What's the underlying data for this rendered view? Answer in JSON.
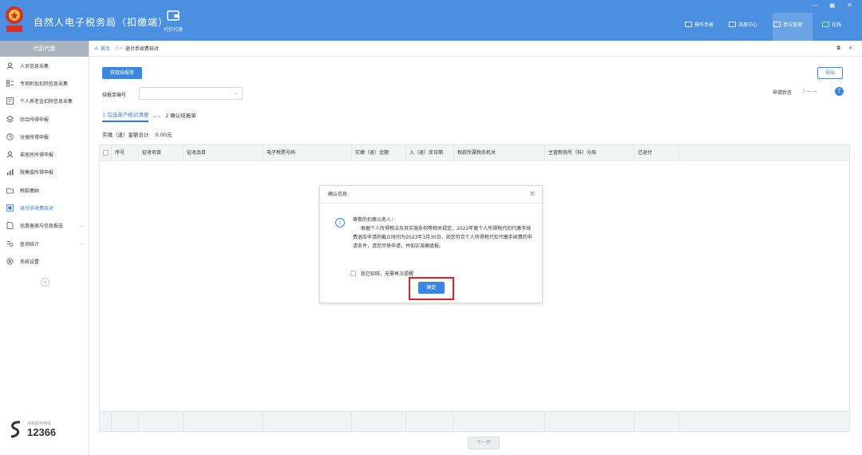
{
  "app": {
    "title": "自然人电子税务局（扣缴端）",
    "logo_text": "中国税务",
    "module_label": "代扣代缴",
    "window_controls": "— ▣ ✕"
  },
  "header": {
    "links": [
      "操作手册",
      "消息中心",
      "单位管理",
      "在线"
    ]
  },
  "sidebar": {
    "title": "代扣代缴",
    "items": [
      {
        "label": "人员信息采集",
        "icon": "person-icon"
      },
      {
        "label": "专项附加扣除信息采集",
        "icon": "list-icon"
      },
      {
        "label": "个人养老金扣除信息采集",
        "icon": "pension-icon"
      },
      {
        "label": "综合所得申报",
        "icon": "layers-icon"
      },
      {
        "label": "分类所得申报",
        "icon": "clock-icon"
      },
      {
        "label": "非居民所得申报",
        "icon": "person-icon"
      },
      {
        "label": "限售股所得申报",
        "icon": "bar-chart-icon"
      },
      {
        "label": "税款缴纳",
        "icon": "folder-icon"
      },
      {
        "label": "退付手续费核对",
        "icon": "document-icon"
      },
      {
        "label": "优惠备案与信息报送",
        "icon": "file-icon"
      },
      {
        "label": "查询统计",
        "icon": "search-list-icon"
      },
      {
        "label": "系统设置",
        "icon": "gear-icon"
      }
    ],
    "active_index": 8,
    "collapse_glyph": "«",
    "hotline_label": "纳税服务热线",
    "hotline_number": "12366"
  },
  "breadcrumb": {
    "home": "首页",
    "separator": ">>",
    "current": "退付手续费核对",
    "tab_controls": "◘ ✕"
  },
  "toolbar": {
    "fetch_label": "获取结报单",
    "export_label": "导出",
    "form_label": "结报单编号",
    "status_label": "申请状态",
    "status_value": "| — —",
    "help_glyph": "?"
  },
  "steps": {
    "step1": "1 勾选单户核对清册",
    "arrow": ">>",
    "step2": "2 确认结报单"
  },
  "total": {
    "label": "实缴（退）金额合计",
    "value": "0.00元"
  },
  "table": {
    "columns": [
      "序号",
      "征收项目",
      "征收品目",
      "电子税票号码",
      "实缴（退）金额",
      "入（退）库日期",
      "税款所属税务机关",
      "主管税务所（科）分局",
      "已退付"
    ]
  },
  "next_button": "下一步",
  "modal": {
    "title": "确认信息",
    "close_glyph": "✕",
    "greeting": "尊敬的扣缴义务人：",
    "body": "根据个人所得税法及其实施条例等相关规定，2022年度个人所得税代扣代缴手续费退库申请的截止时间为2023年3月30日，如您符合个人所得税代扣代缴手续费的申请条件，请您尽快申请，并如实准确填报。",
    "checkbox_label": "我已知晓，无需再次提醒",
    "ok_label": "确定"
  },
  "colors": {
    "header_bg": "#4a8fe0",
    "primary": "#3a86e0",
    "highlight": "#e02020"
  }
}
